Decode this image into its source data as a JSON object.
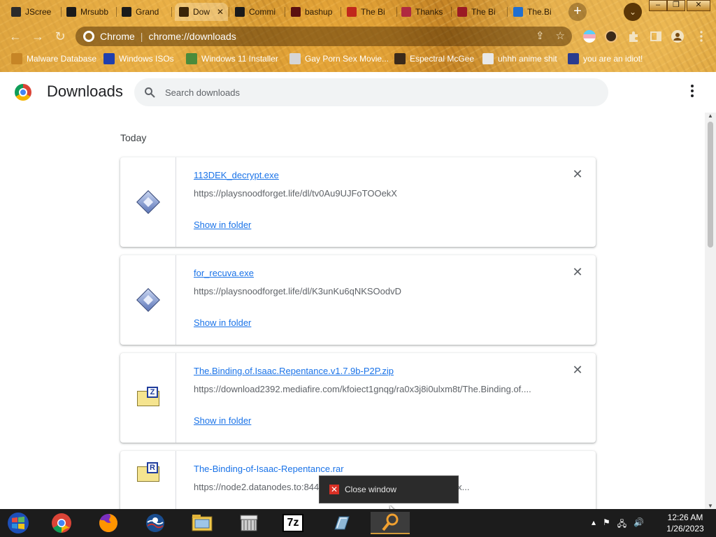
{
  "window": {
    "tabs": [
      {
        "label": "JScree",
        "icon": "monitor-icon",
        "color": "#2b2b2b"
      },
      {
        "label": "Mrsubb",
        "icon": "archive-icon",
        "color": "#1a1a1a"
      },
      {
        "label": "Grand",
        "icon": "archive-icon",
        "color": "#1a1a1a"
      },
      {
        "label": "Dow",
        "icon": "download-icon",
        "color": "#3a2408"
      },
      {
        "label": "Commi",
        "icon": "github-icon",
        "color": "#1a1a1a"
      },
      {
        "label": "bashup",
        "icon": "cloud-icon",
        "color": "#5b1010"
      },
      {
        "label": "The Bi",
        "icon": "isaac-icon",
        "color": "#c0281c"
      },
      {
        "label": "Thanks",
        "icon": "isaac-icon",
        "color": "#b02a40"
      },
      {
        "label": "The Bi",
        "icon": "isaac-icon",
        "color": "#9a1a24"
      },
      {
        "label": "The.Bi",
        "icon": "mediafire-icon",
        "color": "#1f6fd1"
      }
    ],
    "close_glyph": "✕",
    "new_tab_glyph": "+",
    "tab_search_glyph": "⌄",
    "minimize_glyph": "–",
    "maximize_glyph": "❐",
    "close_window_glyph": "✕"
  },
  "toolbar": {
    "back_glyph": "←",
    "forward_glyph": "→",
    "reload_glyph": "↻",
    "site_label": "Chrome",
    "url": "chrome://downloads",
    "share_glyph": "⇪",
    "star_glyph": "☆"
  },
  "bookmarks": [
    {
      "label": "Malware Database",
      "icon": "bug-icon",
      "color": "#c68526"
    },
    {
      "label": "Windows ISOs",
      "icon": "x-icon",
      "color": "#1f3fae"
    },
    {
      "label": "Windows 11 Installer",
      "icon": "image-icon",
      "color": "#4b8b3b"
    },
    {
      "label": "Gay Porn Sex Movie...",
      "icon": "ghost-icon",
      "color": "#d6d6d6"
    },
    {
      "label": "Espectral McGee",
      "icon": "avatar-icon",
      "color": "#3b2a1a"
    },
    {
      "label": "uhhh anime shit",
      "icon": "anime-icon",
      "color": "#e8e8e8"
    },
    {
      "label": "you are an idiot!",
      "icon": "flag-icon",
      "color": "#2a3c8f"
    }
  ],
  "page": {
    "title": "Downloads",
    "search_placeholder": "Search downloads",
    "day_label": "Today"
  },
  "downloads": [
    {
      "name": "113DEK_decrypt.exe",
      "url": "https://playsnoodforget.life/dl/tv0Au9UJFoTOOekX",
      "action": "Show in folder",
      "type": "exe",
      "badge": ""
    },
    {
      "name": "for_recuva.exe",
      "url": "https://playsnoodforget.life/dl/K3unKu6qNKSOodvD",
      "action": "Show in folder",
      "type": "exe",
      "badge": ""
    },
    {
      "name": "The.Binding.of.Isaac.Repentance.v1.7.9b-P2P.zip",
      "url": "https://download2392.mediafire.com/kfoiect1gnqg/ra0x3j8i0ulxm8t/The.Binding.of....",
      "action": "Show in folder",
      "type": "zip",
      "badge": "Z"
    },
    {
      "name": "The-Binding-of-Isaac-Repentance.rar",
      "url": "https://node2.datanodes.to:844",
      "url_tail": "bu4mawimredssgx...",
      "action": "",
      "type": "rar",
      "badge": "R"
    }
  ],
  "tooltip": {
    "label": "Close window"
  },
  "taskbar": {
    "apps": [
      "start-icon",
      "chrome-icon",
      "firefox-icon",
      "obama-icon",
      "explorer-icon",
      "archive-icon",
      "7zip-icon",
      "notepad-icon",
      "search-app-icon"
    ],
    "sevenzip_label": "7z",
    "time": "12:26 AM",
    "date": "1/26/2023"
  }
}
